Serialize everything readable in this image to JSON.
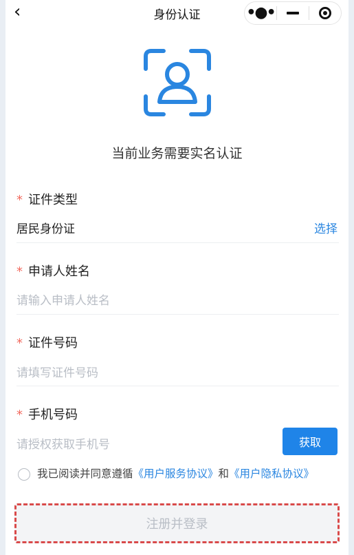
{
  "nav": {
    "back_glyph": "‹",
    "title": "身份认证",
    "more_icon": "more-dots-icon",
    "minimize_icon": "minimize-icon",
    "close_icon": "target-close-icon"
  },
  "header": {
    "icon": "face-recognition-icon",
    "tip": "当前业务需要实名认证"
  },
  "form": {
    "required_mark": "*",
    "id_type": {
      "label": "证件类型",
      "value": "居民身份证",
      "action": "选择"
    },
    "name": {
      "label": "申请人姓名",
      "placeholder": "请输入申请人姓名"
    },
    "id_number": {
      "label": "证件号码",
      "placeholder": "请填写证件号码"
    },
    "phone": {
      "label": "手机号码",
      "placeholder": "请授权获取手机号",
      "button": "获取"
    }
  },
  "agreement": {
    "prefix": "我已阅读并同意遵循",
    "service_link": "《用户服务协议》",
    "and": "和",
    "privacy_link": "《用户隐私协议》"
  },
  "submit": {
    "label": "注册并登录"
  },
  "colors": {
    "accent": "#1f84e8",
    "required": "#f26a5e",
    "highlight_border": "#d94a4a"
  }
}
